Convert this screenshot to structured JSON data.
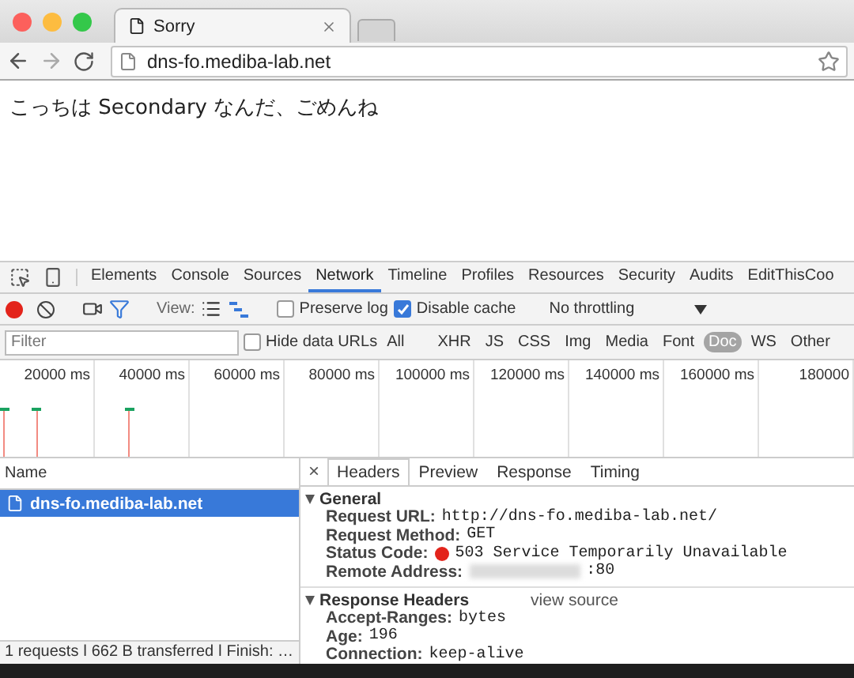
{
  "browser": {
    "tabs": [
      {
        "title": "Sorry",
        "selected": true,
        "kind": "page"
      },
      {
        "kind": "new"
      }
    ],
    "address": {
      "url": "dns-fo.mediba-lab.net"
    }
  },
  "page": {
    "text": "こっちは Secondary なんだ、ごめんね"
  },
  "devtools": {
    "panel_tabs": [
      {
        "label": "Elements",
        "selected": false
      },
      {
        "label": "Console",
        "selected": false
      },
      {
        "label": "Sources",
        "selected": false
      },
      {
        "label": "Network",
        "selected": true
      },
      {
        "label": "Timeline",
        "selected": false
      },
      {
        "label": "Profiles",
        "selected": false
      },
      {
        "label": "Resources",
        "selected": false
      },
      {
        "label": "Security",
        "selected": false
      },
      {
        "label": "Audits",
        "selected": false
      },
      {
        "label": "EditThisCoo",
        "selected": false
      }
    ],
    "toolbar": {
      "recording": true,
      "filter_on": true,
      "view_label": "View:",
      "preserve_log": {
        "label": "Preserve log",
        "checked": false
      },
      "disable_cache": {
        "label": "Disable cache",
        "checked": true
      },
      "throttling": "No throttling"
    },
    "filter": {
      "placeholder": "Filter",
      "hide_data_urls": {
        "label": "Hide data URLs",
        "checked": false
      },
      "types": [
        {
          "label": "All",
          "selected": false
        },
        {
          "label": "XHR",
          "selected": false
        },
        {
          "label": "JS",
          "selected": false
        },
        {
          "label": "CSS",
          "selected": false
        },
        {
          "label": "Img",
          "selected": false
        },
        {
          "label": "Media",
          "selected": false
        },
        {
          "label": "Font",
          "selected": false
        },
        {
          "label": "Doc",
          "selected": true
        },
        {
          "label": "WS",
          "selected": false
        },
        {
          "label": "Other",
          "selected": false
        }
      ]
    },
    "timeline": {
      "ticks": [
        "20000 ms",
        "40000 ms",
        "60000 ms",
        "80000 ms",
        "100000 ms",
        "120000 ms",
        "140000 ms",
        "160000 ms",
        "180000"
      ]
    },
    "requests": {
      "header": "Name",
      "rows": [
        {
          "name": "dns-fo.mediba-lab.net",
          "selected": true
        }
      ],
      "summary": "1 requests ǀ 662 B transferred ǀ Finish: …"
    },
    "details": {
      "close": "×",
      "tabs": [
        {
          "label": "Headers",
          "selected": true
        },
        {
          "label": "Preview",
          "selected": false
        },
        {
          "label": "Response",
          "selected": false
        },
        {
          "label": "Timing",
          "selected": false
        }
      ],
      "sections": [
        {
          "title": "General",
          "expanded": true,
          "entries": [
            {
              "label": "Request URL:",
              "value": "http://dns-fo.mediba-lab.net/",
              "kind": "plain"
            },
            {
              "label": "Request Method:",
              "value": "GET",
              "kind": "plain"
            },
            {
              "label": "Status Code:",
              "value": "503 Service Temporarily Unavailable",
              "kind": "status"
            },
            {
              "label": "Remote Address:",
              "value": ":80",
              "kind": "redacted"
            }
          ]
        },
        {
          "title": "Response Headers",
          "expanded": true,
          "link": "view source",
          "entries": [
            {
              "label": "Accept-Ranges:",
              "value": "bytes",
              "kind": "plain"
            },
            {
              "label": "Age:",
              "value": "196",
              "kind": "plain"
            },
            {
              "label": "Connection:",
              "value": "keep-alive",
              "kind": "plain"
            }
          ]
        }
      ]
    }
  }
}
